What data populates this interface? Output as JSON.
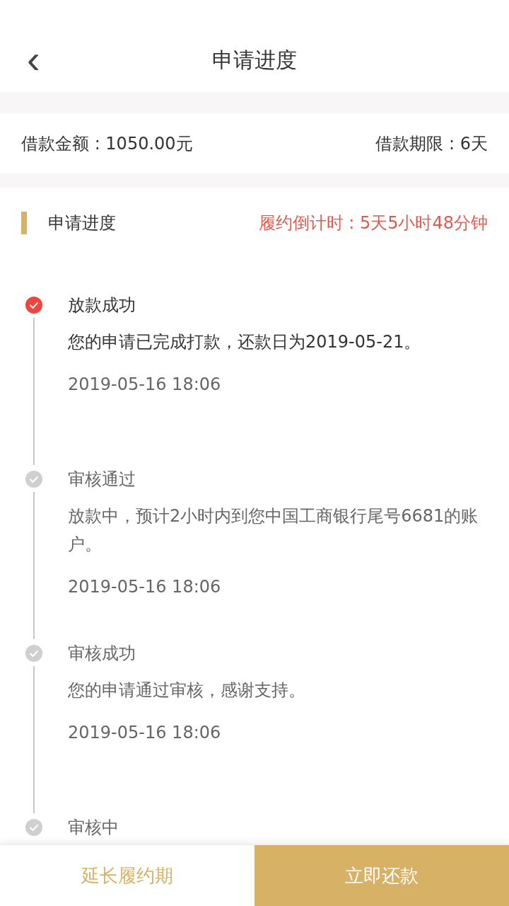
{
  "header": {
    "back": "‹",
    "title": "申请进度"
  },
  "loan": {
    "amount": "借款金额 : 1050.00元",
    "term": "借款期限 : 6天"
  },
  "progress": {
    "title": "申请进度",
    "countdown": "履约倒计时 : 5天5小时48分钟",
    "steps": [
      {
        "title": "放款成功",
        "description": "您的申请已完成打款，还款日为2019-05-21。",
        "time": "2019-05-16 18:06",
        "current": true
      },
      {
        "title": "审核通过",
        "description": "放款中，预计2小时内到您中国工商银行尾号6681的账户。",
        "time": "2019-05-16 18:06",
        "current": false
      },
      {
        "title": "审核成功",
        "description": "您的申请通过审核，感谢支持。",
        "time": "2019-05-16 18:06",
        "current": false
      },
      {
        "title": "审核中",
        "current": false
      }
    ]
  },
  "buttons": [
    {
      "label": "延长履约期",
      "primary": false
    },
    {
      "label": "立即还款",
      "primary": true
    }
  ]
}
